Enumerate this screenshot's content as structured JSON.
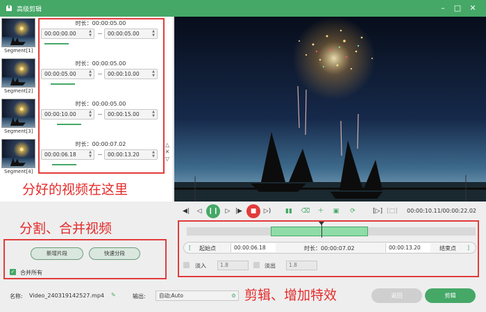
{
  "window": {
    "title": "高级剪辑"
  },
  "segments": [
    {
      "label": "Segment[1]",
      "duration": "时长：00:00:05.00",
      "start": "00:00:00.00",
      "end": "00:00:05.00",
      "progress": 0.0
    },
    {
      "label": "Segment[2]",
      "duration": "时长：00:00:05.00",
      "start": "00:00:05.00",
      "end": "00:00:10.00",
      "progress": 0.22
    },
    {
      "label": "Segment[3]",
      "duration": "时长：00:00:05.00",
      "start": "00:00:10.00",
      "end": "00:00:15.00",
      "progress": 0.45
    },
    {
      "label": "Segment[4]",
      "duration": "时长：00:00:07.02",
      "start": "00:00:06.18",
      "end": "00:00:13.20",
      "progress": 0.28
    }
  ],
  "annotations": {
    "segments_note": "分好的视频在这里",
    "split_note": "分割、合并视频",
    "edit_note": "剪辑、增加特效"
  },
  "actions": {
    "new_segment": "新增片段",
    "quick_split": "快速分段",
    "merge_all": "合并所有"
  },
  "player": {
    "timecode": "00:00:10.11/00:00:22.02",
    "selection_start": 0.29,
    "selection_end": 0.63,
    "playhead": 0.46
  },
  "trim": {
    "start_label": "起始点",
    "start_value": "00:00:06.18",
    "duration": "时长：00:00:07.02",
    "end_value": "00:00:13.20",
    "end_label": "结束点",
    "bracket_left": "[",
    "bracket_right": "]"
  },
  "effects": {
    "fade_in_label": "淡入",
    "fade_in_value": "1.8",
    "fade_out_label": "淡出",
    "fade_out_value": "1.8"
  },
  "footer": {
    "name_label": "名称:",
    "name_value": "Video_240319142527.mp4",
    "output_label": "输出:",
    "output_value": "自动;Auto",
    "back": "返回",
    "cut": "剪辑"
  },
  "colors": {
    "accent": "#45a867",
    "annotation": "#e33b3b"
  }
}
